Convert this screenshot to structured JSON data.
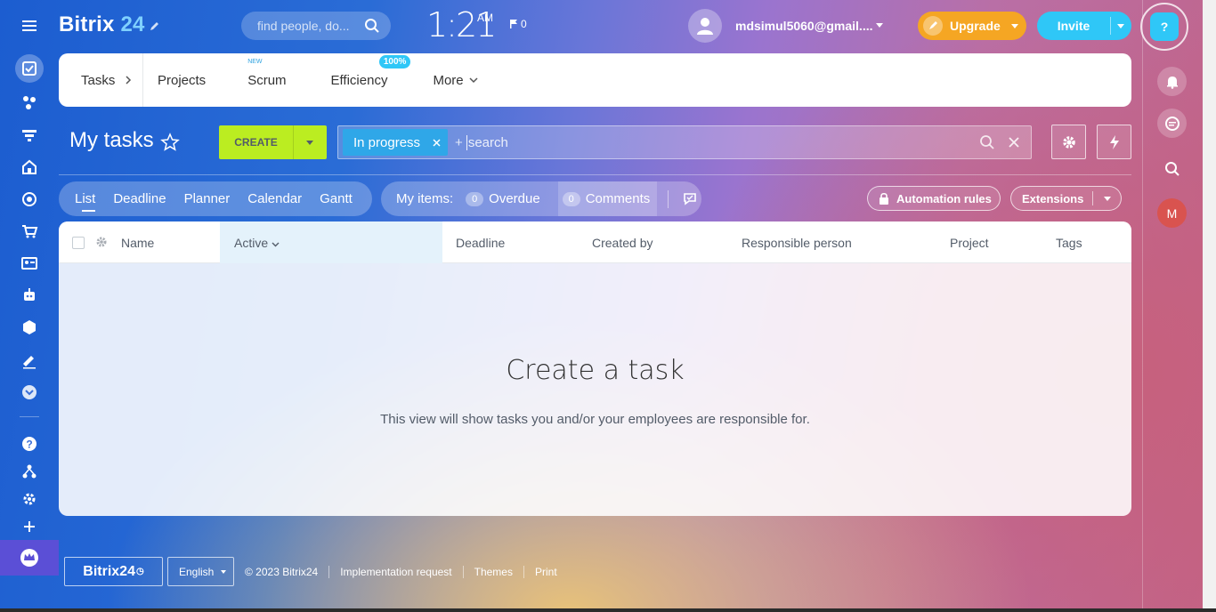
{
  "header": {
    "logo_main": "Bitrix",
    "logo_num": "24",
    "search_placeholder": "find people, do...",
    "clock": "1:21",
    "clock_ampm": "AM",
    "flag_count": "0",
    "user_email": "mdsimul5060@gmail....",
    "upgrade_label": "Upgrade",
    "invite_label": "Invite",
    "help_label": "?"
  },
  "nav": {
    "tasks": "Tasks",
    "projects": "Projects",
    "scrum": "Scrum",
    "scrum_badge": "NEW",
    "efficiency": "Efficiency",
    "efficiency_badge": "100%",
    "more": "More"
  },
  "toolbar": {
    "title": "My tasks",
    "create_label": "CREATE",
    "filter_chip": "In progress",
    "filter_plus": "+",
    "search_placeholder": "search"
  },
  "views": {
    "tabs": [
      "List",
      "Deadline",
      "Planner",
      "Calendar",
      "Gantt"
    ],
    "active": "List",
    "my_items_label": "My items:",
    "overdue_count": "0",
    "overdue_label": "Overdue",
    "comments_count": "0",
    "comments_label": "Comments",
    "automation_label": "Automation rules",
    "extensions_label": "Extensions"
  },
  "grid": {
    "columns": [
      "Name",
      "Active",
      "Deadline",
      "Created by",
      "Responsible person",
      "Project",
      "Tags"
    ],
    "empty_title": "Create a task",
    "empty_text": "This view will show tasks you and/or your employees are responsible for."
  },
  "right_sidebar": {
    "user_initial": "M"
  },
  "footer": {
    "logo": "Bitrix24",
    "language": "English",
    "copyright": "© 2023 Bitrix24",
    "links": [
      "Implementation request",
      "Themes",
      "Print"
    ]
  },
  "colors": {
    "create_green": "#bbed21",
    "upgrade_orange": "#f5a623",
    "invite_blue": "#2fc7f7",
    "chip_blue": "#2fa7e8",
    "avatar_red": "#d9534f"
  }
}
